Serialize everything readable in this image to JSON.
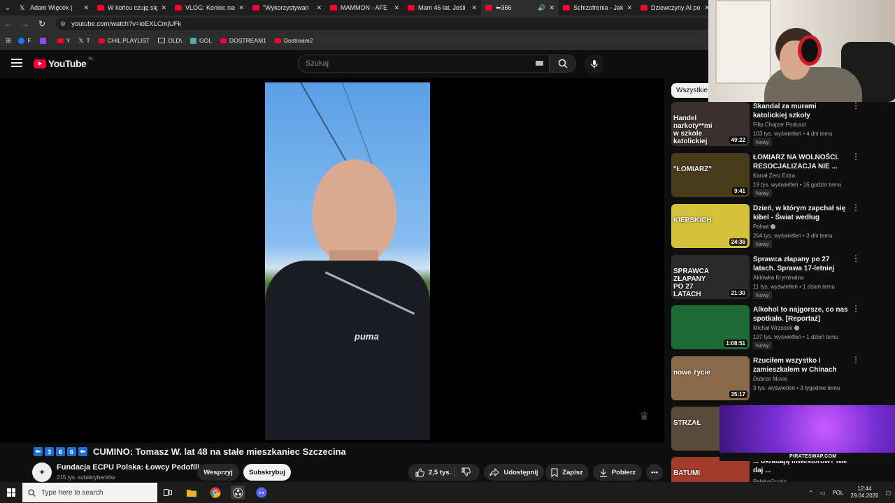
{
  "browser": {
    "tabs": [
      {
        "label": "Adam Więcek |",
        "icon": "x-icon",
        "active": false
      },
      {
        "label": "W końcu czuję się",
        "icon": "youtube-icon",
        "active": false
      },
      {
        "label": "VLOG: Koniec nas",
        "icon": "youtube-icon",
        "active": false
      },
      {
        "label": "\"Wykorzystywan",
        "icon": "youtube-icon",
        "active": false
      },
      {
        "label": "MAMMON - AFE",
        "icon": "youtube-icon",
        "active": false
      },
      {
        "label": "Mam 46 lat. Jeśli",
        "icon": "youtube-icon",
        "active": false
      },
      {
        "label": "⬅3︎6︎6",
        "icon": "youtube-icon",
        "active": true
      },
      {
        "label": "Schizofrenia - Jak",
        "icon": "youtube-icon",
        "active": false
      },
      {
        "label": "Dziewczyny AI po",
        "icon": "youtube-icon",
        "active": false
      }
    ],
    "url": "youtube.com/watch?v=ioEXLCmjUFk",
    "bookmarks": [
      {
        "label": "F",
        "icon": "facebook-icon"
      },
      {
        "label": "",
        "icon": "twitch-icon"
      },
      {
        "label": "Y",
        "icon": "youtube-icon"
      },
      {
        "label": "T",
        "icon": "x-icon"
      },
      {
        "label": "CHIL PLAYLIST",
        "icon": "youtube-icon"
      },
      {
        "label": "OLD\\",
        "icon": "folder-icon"
      },
      {
        "label": "GOL",
        "icon": "gol-icon"
      },
      {
        "label": "DOSTREAM1",
        "icon": "youtube-icon"
      },
      {
        "label": "Dostream2",
        "icon": "youtube-icon"
      }
    ]
  },
  "youtube": {
    "logo_text": "YouTube",
    "country_code": "PL",
    "search_placeholder": "Szukaj"
  },
  "video": {
    "shirt_text": "puma",
    "title_badges": [
      "⬅",
      "3",
      "6",
      "6",
      "⬅"
    ],
    "title": "CUMINO: Tomasz W. lat 48 na stałe mieszkaniec Szczecina",
    "channel": "Fundacja ECPU Polska: Łowcy Pedofili",
    "subscribers": "215 tys. subskrybentów",
    "support_label": "Wesprzyj",
    "subscribe_label": "Subskrybuj",
    "likes": "2,5 tys.",
    "share_label": "Udostępnij",
    "save_label": "Zapisz",
    "download_label": "Pobierz"
  },
  "sidebar": {
    "chip": "Wszystkie",
    "items": [
      {
        "title": "Skandal za murami katolickiej szkoły",
        "channel": "Filip Chajzer Podcast",
        "verified": false,
        "meta": "103 tys. wyświetleń • 4 dni temu",
        "badge": "Nowy",
        "duration": "49:22",
        "thumb_text": "Handel narkoty**mi w szkole katolickiej",
        "thumb_bg": "#3b3030"
      },
      {
        "title": "ŁOMIARZ NA WOLNOŚCI. RESOCJALIZACJA NIE ...",
        "channel": "Kanał Zero Extra",
        "verified": false,
        "meta": "19 tys. wyświetleń • 16 godzin temu",
        "badge": "Nowy",
        "duration": "9:41",
        "thumb_text": "\"ŁOMIARZ\"",
        "thumb_bg": "#4a3b1c"
      },
      {
        "title": "Dzień, w którym zapchał się kibel - Świat według Kiepskich...",
        "channel": "Polsat",
        "verified": true,
        "meta": "264 tys. wyświetleń • 3 dni temu",
        "badge": "Nowy",
        "duration": "24:36",
        "thumb_text": "KIEPSKICH",
        "thumb_bg": "#d6c23a"
      },
      {
        "title": "Sprawca złapany po 27 latach. Sprawa 17-letniej Barbary Ż.",
        "channel": "Aktówka Kryminalna",
        "verified": false,
        "meta": "11 tys. wyświetleń • 1 dzień temu",
        "badge": "Nowy",
        "duration": "21:30",
        "thumb_text": "SPRAWCA ZŁAPANY PO 27 LATACH",
        "thumb_bg": "#2b2b2b"
      },
      {
        "title": "Alkohol to najgorsze, co nas spotkało. [Reportaż]",
        "channel": "Michał Wrzosek",
        "verified": true,
        "meta": "127 tys. wyświetleń • 1 dzień temu",
        "badge": "Nowy",
        "duration": "1:08:51",
        "thumb_text": "",
        "thumb_bg": "#1f6a35"
      },
      {
        "title": "Rzuciłem wszystko i zamieszkałem w Chinach (nie ...",
        "channel": "Dobrze Movie",
        "verified": false,
        "meta": "3 tys. wyświetleń • 3 tygodnie temu",
        "badge": "",
        "duration": "35:17",
        "thumb_text": "nowe życie",
        "thumb_bg": "#8a6a4a"
      },
      {
        "title": "",
        "channel": "",
        "verified": false,
        "meta": "",
        "badge": "",
        "duration": "",
        "thumb_text": "STRZAŁ",
        "thumb_bg": "#5a4a3a"
      },
      {
        "title": "... okradają inwestorów? Nie daj ...",
        "channel": "PolakoGruzin",
        "verified": false,
        "meta": "",
        "badge": "",
        "duration": "",
        "thumb_text": "BATUMI",
        "thumb_bg": "#a33b2a"
      }
    ]
  },
  "overlay": {
    "site": "PIRATESWAP.COM"
  },
  "taskbar": {
    "search_placeholder": "Type here to search",
    "language": "POL",
    "time": "12:44",
    "date": "29.04.2026"
  }
}
